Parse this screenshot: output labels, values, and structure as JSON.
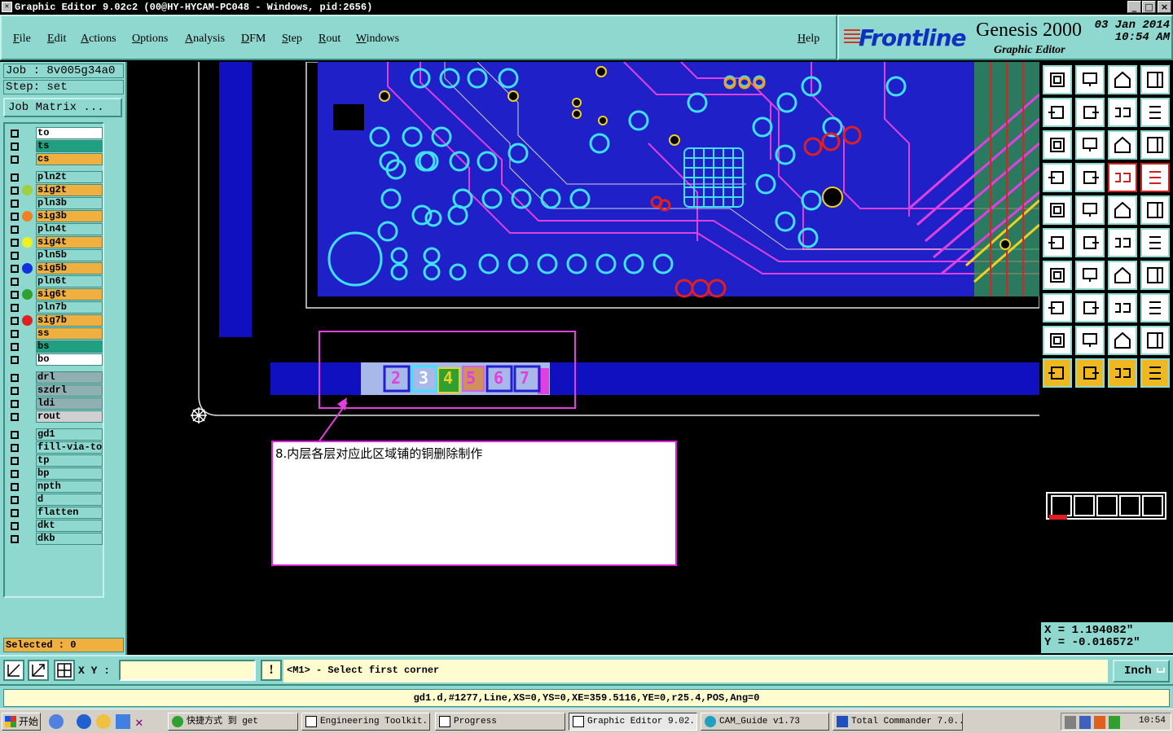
{
  "window": {
    "title": "Graphic Editor 9.02c2 (00@HY-HYCAM-PC048 - Windows, pid:2656)",
    "min": "_",
    "max": "□",
    "close": "×"
  },
  "menu": {
    "items": [
      "File",
      "Edit",
      "Actions",
      "Options",
      "Analysis",
      "DFM",
      "Step",
      "Rout",
      "Windows"
    ],
    "help": "Help"
  },
  "brand": {
    "logo": "Frontline",
    "product": "Genesis 2000",
    "subtitle": "Graphic Editor",
    "date": "03 Jan 2014",
    "time": "10:54 AM"
  },
  "job": {
    "job_label": "Job : 8v005g34a0",
    "step_label": "Step: set",
    "matrix_button": "Job Matrix ..."
  },
  "layers": [
    {
      "name": "to",
      "color": "#ffffff",
      "dot": ""
    },
    {
      "name": "ts",
      "color": "#20a080",
      "dot": ""
    },
    {
      "name": "cs",
      "color": "#f0b040",
      "dot": ""
    },
    {
      "name": "pln2t",
      "color": "#8fd8d0",
      "dot": ""
    },
    {
      "name": "sig2t",
      "color": "#f0b040",
      "dot": "#a0d040"
    },
    {
      "name": "pln3b",
      "color": "#8fd8d0",
      "dot": ""
    },
    {
      "name": "sig3b",
      "color": "#f0b040",
      "dot": "#f08020"
    },
    {
      "name": "pln4t",
      "color": "#8fd8d0",
      "dot": ""
    },
    {
      "name": "sig4t",
      "color": "#f0b040",
      "dot": "#f0f020"
    },
    {
      "name": "pln5b",
      "color": "#8fd8d0",
      "dot": ""
    },
    {
      "name": "sig5b",
      "color": "#f0b040",
      "dot": "#1030e0"
    },
    {
      "name": "pln6t",
      "color": "#8fd8d0",
      "dot": ""
    },
    {
      "name": "sig6t",
      "color": "#f0b040",
      "dot": "#30a030"
    },
    {
      "name": "pln7b",
      "color": "#8fd8d0",
      "dot": ""
    },
    {
      "name": "sig7b",
      "color": "#f0b040",
      "dot": "#e02020"
    },
    {
      "name": "ss",
      "color": "#f0b040",
      "dot": ""
    },
    {
      "name": "bs",
      "color": "#20a080",
      "dot": ""
    },
    {
      "name": "bo",
      "color": "#ffffff",
      "dot": ""
    },
    {
      "name": "drl",
      "color": "#8fb0b0",
      "dot": ""
    },
    {
      "name": "szdrl",
      "color": "#8fb0b0",
      "dot": ""
    },
    {
      "name": "ldi",
      "color": "#8fb0b0",
      "dot": ""
    },
    {
      "name": "rout",
      "color": "#d0d0d0",
      "dot": ""
    },
    {
      "name": "gd1",
      "color": "#8fd8d0",
      "dot": ""
    },
    {
      "name": "fill-via-top",
      "color": "#8fd8d0",
      "dot": ""
    },
    {
      "name": "tp",
      "color": "#8fd8d0",
      "dot": ""
    },
    {
      "name": "bp",
      "color": "#8fd8d0",
      "dot": ""
    },
    {
      "name": "npth",
      "color": "#8fd8d0",
      "dot": ""
    },
    {
      "name": "d",
      "color": "#8fd8d0",
      "dot": ""
    },
    {
      "name": "flatten",
      "color": "#8fd8d0",
      "dot": ""
    },
    {
      "name": "dkt",
      "color": "#8fd8d0",
      "dot": ""
    },
    {
      "name": "dkb",
      "color": "#8fd8d0",
      "dot": ""
    }
  ],
  "selected": "Selected : 0",
  "annotation": {
    "text": "8.内层各层对应此区域铺的铜删除制作"
  },
  "strip_labels": [
    "2",
    "3",
    "4",
    "5",
    "6",
    "7"
  ],
  "coords": {
    "x": "X = 1.194082\"",
    "y": "Y = -0.016572\""
  },
  "command": {
    "xy_label": "X Y :",
    "xy_value": "",
    "warn": "!",
    "prompt": "<M1> - Select first corner",
    "units": "Inch"
  },
  "status": "gd1.d,#1277,Line,XS=0,YS=0,XE=359.5116,YE=0,r25.4,POS,Ang=0",
  "taskbar": {
    "start": "开始",
    "tasks": [
      "快捷方式 到 get",
      "Engineering Toolkit...",
      "Progress",
      "Graphic Editor 9.02...",
      "CAM_Guide v1.73",
      "Total Commander 7.0..."
    ],
    "clock": "10:54"
  }
}
